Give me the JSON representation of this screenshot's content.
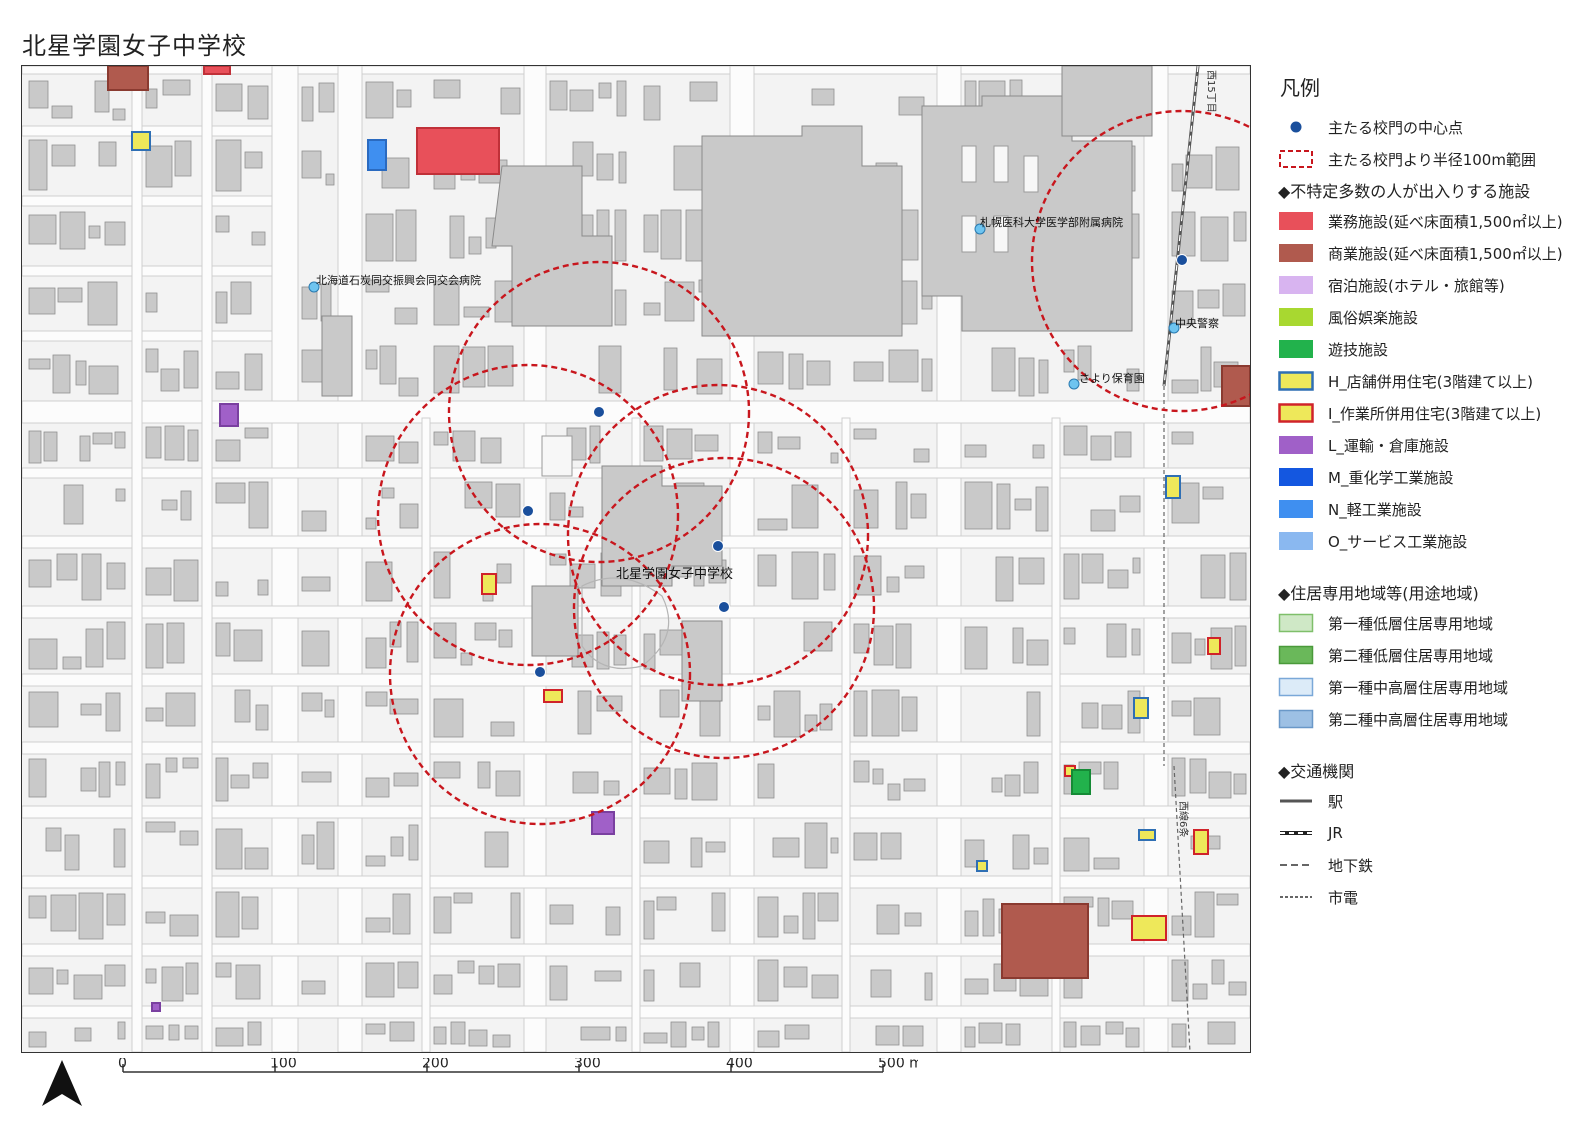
{
  "title": "北星学園女子中学校",
  "map": {
    "labels": {
      "school": "北星学園女子中学校",
      "hospital1": "北海道石炭同交振興会同交会病院",
      "hospital2": "札幌医科大学医学部附属病院",
      "nursery": "さより保育園",
      "police": "中央警察",
      "street_top": "西15丁目",
      "street_right": "西線6条"
    }
  },
  "legend": {
    "title": "凡例",
    "items": [
      {
        "key": "gate_point",
        "label": "主たる校門の中心点"
      },
      {
        "key": "radius",
        "label": "主たる校門より半径100m範囲"
      },
      {
        "key": "h1",
        "label": "◆不特定多数の人が出入りする施設",
        "header": true
      },
      {
        "key": "office",
        "label": "業務施設(延べ床面積1,500㎡以上)",
        "color": "#e8505a"
      },
      {
        "key": "commercial",
        "label": "商業施設(延べ床面積1,500㎡以上)",
        "color": "#b05a4e"
      },
      {
        "key": "lodging",
        "label": "宿泊施設(ホテル・旅館等)",
        "color": "#d8b4f0"
      },
      {
        "key": "entertainment",
        "label": "風俗娯楽施設",
        "color": "#a8d830"
      },
      {
        "key": "amusement",
        "label": "遊技施設",
        "color": "#22b24c"
      },
      {
        "key": "h_shop",
        "label": "H_店舗併用住宅(3階建て以上)",
        "color": "#eee85a",
        "border": "#2f6fb4"
      },
      {
        "key": "i_work",
        "label": "I_作業所併用住宅(3階建て以上)",
        "color": "#eee85a",
        "border": "#d0232a"
      },
      {
        "key": "l_transport",
        "label": "L_運輸・倉庫施設",
        "color": "#a060c8"
      },
      {
        "key": "m_heavy",
        "label": "M_重化学工業施設",
        "color": "#1457e0"
      },
      {
        "key": "n_light",
        "label": "N_軽工業施設",
        "color": "#3f8ff0"
      },
      {
        "key": "o_service",
        "label": "O_サービス工業施設",
        "color": "#8ab8f0"
      },
      {
        "key": "h2",
        "label": "◆住居専用地域等(用途地域)",
        "header": true
      },
      {
        "key": "r1low",
        "label": "第一種低層住居専用地域",
        "color": "#cfe8c6",
        "border": "#7fbf6a"
      },
      {
        "key": "r2low",
        "label": "第二種低層住居専用地域",
        "color": "#6ab85a",
        "border": "#4a9a3a"
      },
      {
        "key": "r1mid",
        "label": "第一種中高層住居専用地域",
        "color": "#dcebf8",
        "border": "#7aa8d8"
      },
      {
        "key": "r2mid",
        "label": "第二種中高層住居専用地域",
        "color": "#9dc0e4",
        "border": "#6a98c8"
      },
      {
        "key": "h3",
        "label": "◆交通機関",
        "header": true
      },
      {
        "key": "station",
        "label": "駅"
      },
      {
        "key": "jr",
        "label": "JR"
      },
      {
        "key": "subway",
        "label": "地下鉄"
      },
      {
        "key": "tram",
        "label": "市電"
      }
    ]
  },
  "scale": {
    "ticks": [
      "0",
      "100",
      "200",
      "300",
      "400",
      "500 m"
    ]
  }
}
